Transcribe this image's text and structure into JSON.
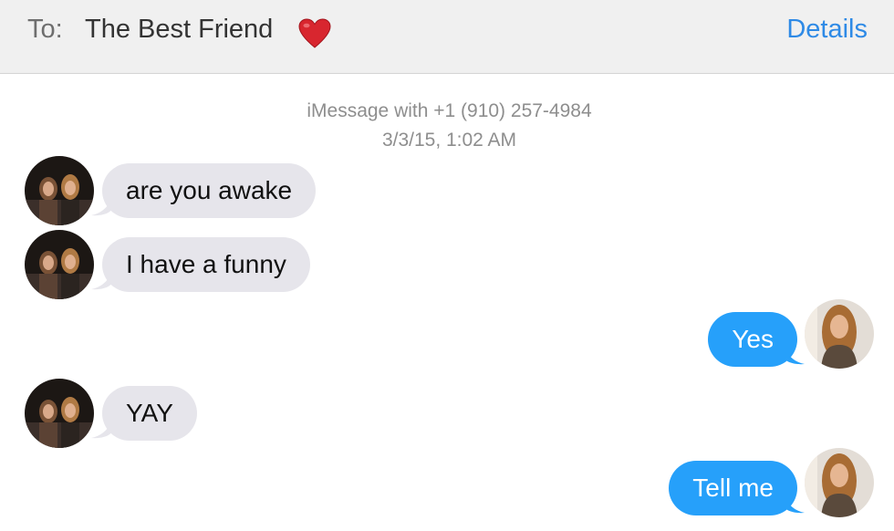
{
  "header": {
    "to_label": "To:",
    "recipient_name": "The Best Friend",
    "recipient_emoji": "heart",
    "details_label": "Details"
  },
  "conversation": {
    "service_line": "iMessage with +1 (910) 257-4984",
    "timestamp": "3/3/15, 1:02 AM",
    "messages": [
      {
        "direction": "incoming",
        "text": "are you awake"
      },
      {
        "direction": "incoming",
        "text": "I have a funny"
      },
      {
        "direction": "outgoing",
        "text": "Yes"
      },
      {
        "direction": "incoming",
        "text": "YAY"
      },
      {
        "direction": "outgoing",
        "text": "Tell me"
      }
    ]
  },
  "colors": {
    "header_bg": "#f0f0f0",
    "link_blue": "#2e8ae6",
    "incoming_bubble": "#e6e5eb",
    "outgoing_bubble": "#26a0fa",
    "heart_red": "#d8262f"
  }
}
